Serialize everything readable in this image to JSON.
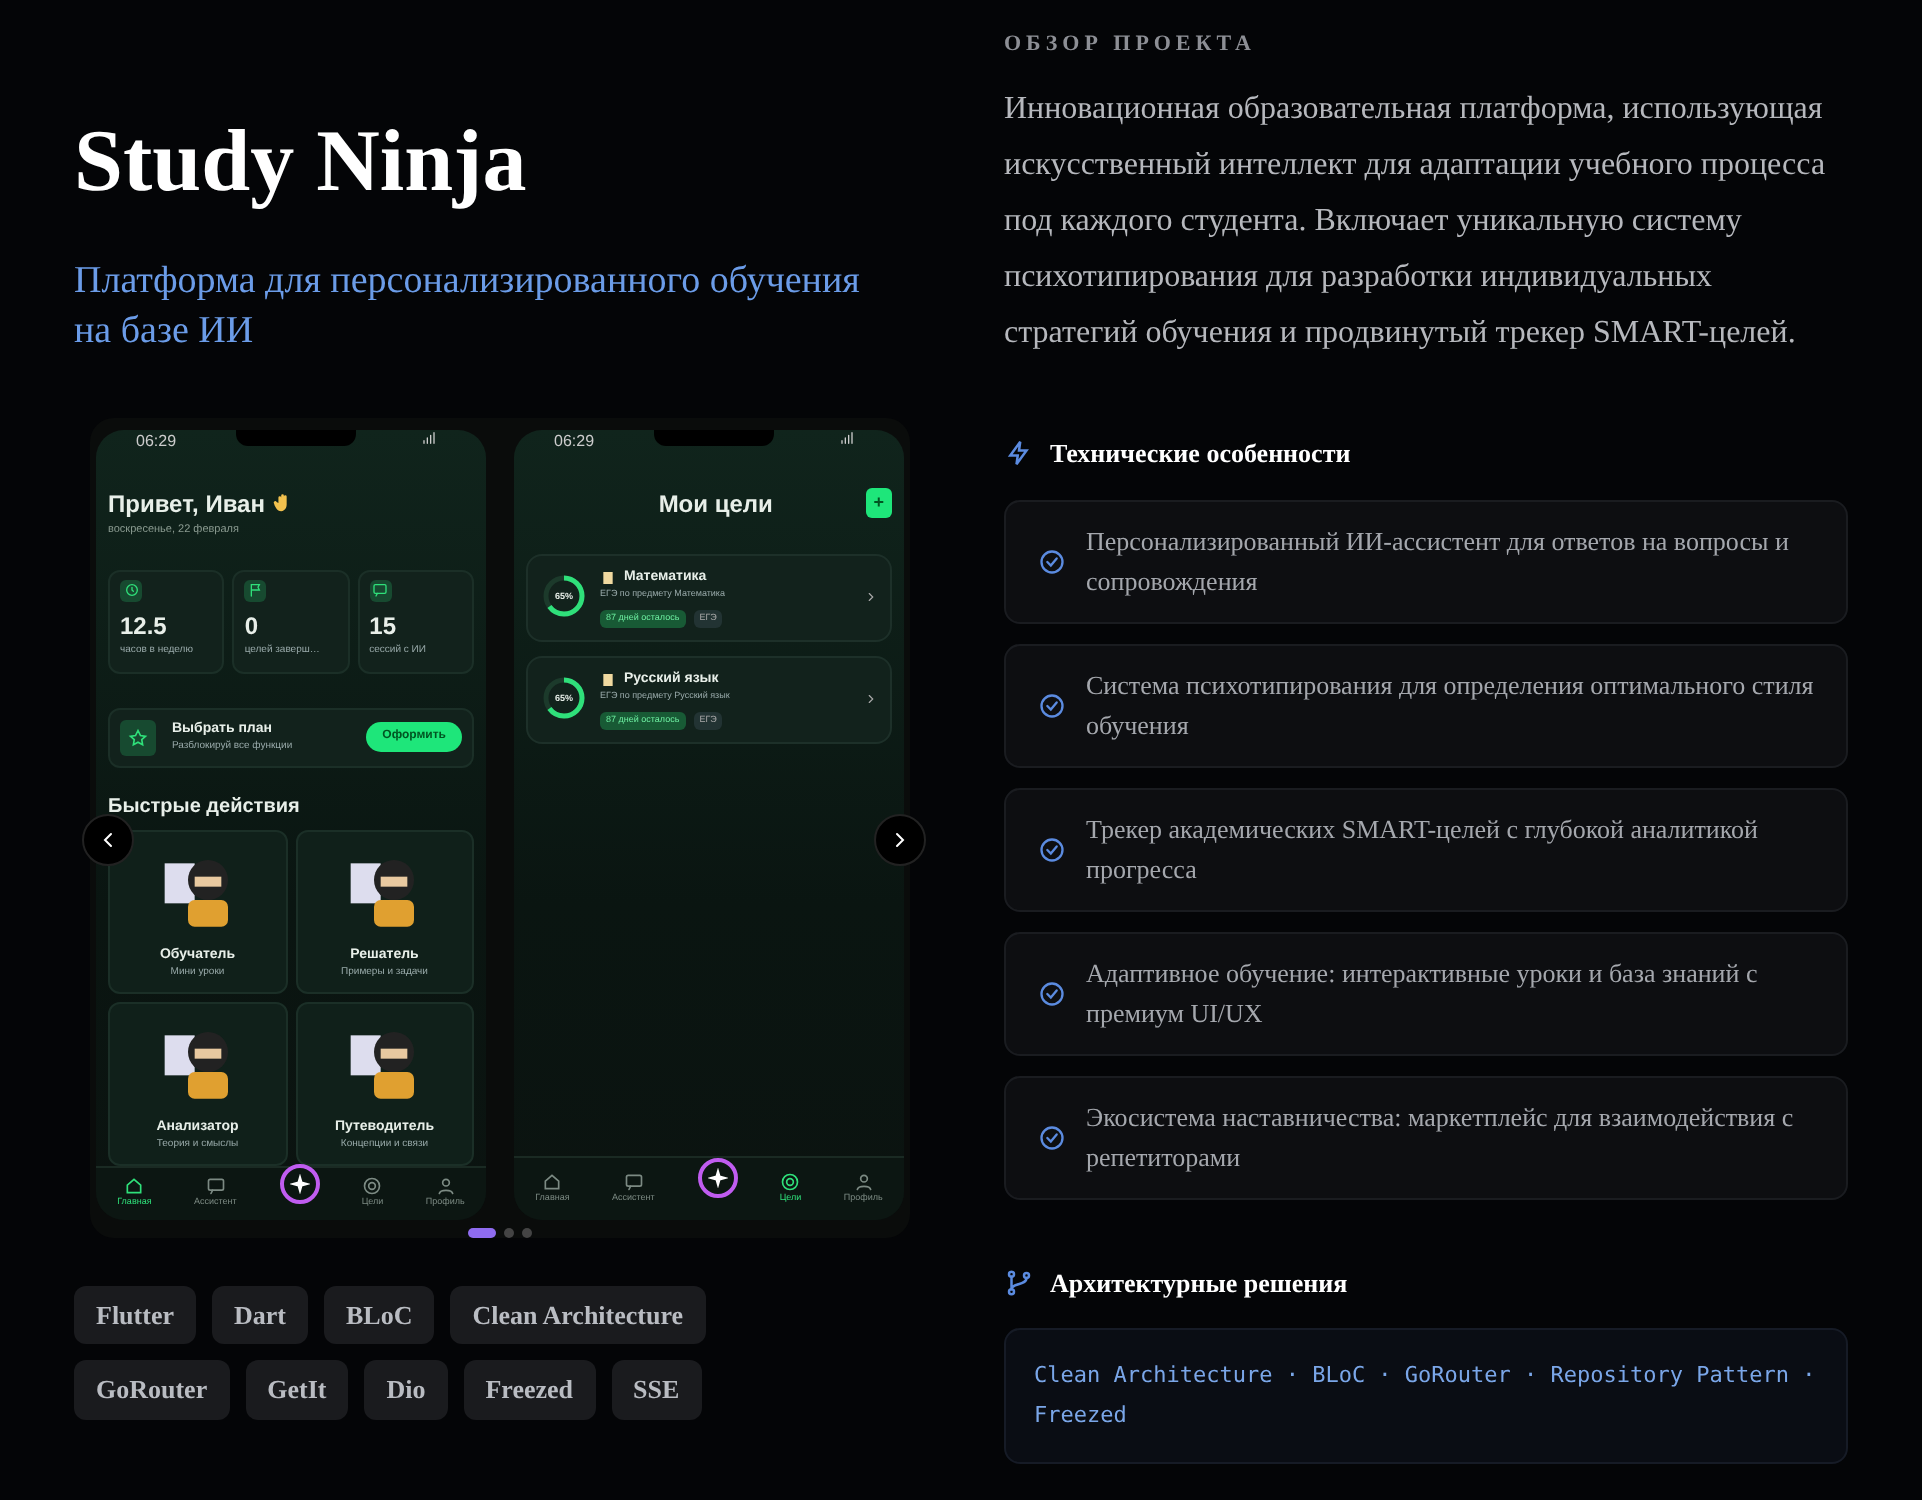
{
  "header": {
    "title": "Study Ninja",
    "subtitle": "Платформа для персонализированного обучения на базе ИИ"
  },
  "carousel": {
    "screens": [
      {
        "kind": "home",
        "time": "06:29",
        "greeting": "Привет, Иван",
        "date": "воскресенье, 22 февраля",
        "stats": [
          {
            "kind": "clock",
            "value": "12.5",
            "label": "часов в неделю"
          },
          {
            "kind": "flag",
            "value": "0",
            "label": "целей заверш…"
          },
          {
            "kind": "chat",
            "value": "15",
            "label": "сессий с ИИ"
          }
        ],
        "plan": {
          "title": "Выбрать план",
          "subtitle": "Разблокируй все функции",
          "button": "Оформить"
        },
        "section": "Быстрые действия",
        "actions": [
          {
            "title": "Обучатель",
            "subtitle": "Мини уроки"
          },
          {
            "title": "Решатель",
            "subtitle": "Примеры и задачи"
          },
          {
            "title": "Анализатор",
            "subtitle": "Теория и смыслы"
          },
          {
            "title": "Путеводитель",
            "subtitle": "Концепции и связи"
          }
        ],
        "nav": [
          {
            "kind": "home",
            "label": "Главная",
            "selected": true
          },
          {
            "kind": "chat",
            "label": "Ассистент",
            "selected": false
          },
          {
            "kind": "target",
            "label": "Цели",
            "selected": false
          },
          {
            "kind": "user",
            "label": "Профиль",
            "selected": false
          }
        ]
      },
      {
        "kind": "goals",
        "time": "06:29",
        "title": "Мои цели",
        "add": "+",
        "goals": [
          {
            "title": "Математика",
            "subtitle": "ЕГЭ по предмету Математика",
            "percent": "65%",
            "level": 0.65,
            "badge": "87 дней осталось",
            "tag": "ЕГЭ"
          },
          {
            "title": "Русский язык",
            "subtitle": "ЕГЭ по предмету Русский язык",
            "percent": "65%",
            "level": 0.65,
            "badge": "87 дней осталось",
            "tag": "ЕГЭ"
          }
        ],
        "nav": [
          {
            "kind": "home",
            "label": "Главная",
            "selected": false
          },
          {
            "kind": "chat",
            "label": "Ассистент",
            "selected": false
          },
          {
            "kind": "target",
            "label": "Цели",
            "selected": true
          },
          {
            "kind": "user",
            "label": "Профиль",
            "selected": false
          }
        ]
      }
    ],
    "dots": [
      {
        "selected": true
      },
      {
        "selected": false
      },
      {
        "selected": false
      }
    ]
  },
  "tags": [
    "Flutter",
    "Dart",
    "BLoC",
    "Clean Architecture",
    "GoRouter",
    "GetIt",
    "Dio",
    "Freezed",
    "SSE"
  ],
  "overview": {
    "label": "ОБЗОР ПРОЕКТА",
    "text": "Инновационная образовательная платформа, использующая искусственный интеллект для адаптации учебного процесса под каждого студента. Включает уникальную систему психотипирования для разработки индивидуальных стратегий обучения и продвинутый трекер SMART-целей."
  },
  "features": {
    "title": "Технические особенности",
    "items": [
      "Персонализированный ИИ-ассистент для ответов на вопросы и сопровождения",
      "Система психотипирования для определения оптимального стиля обучения",
      "Трекер академических SMART-целей с глубокой аналитикой прогресса",
      "Адаптивное обучение: интерактивные уроки и база знаний с премиум UI/UX",
      "Экосистема наставничества: маркетплейс для взаимодействия с репетиторами"
    ]
  },
  "architecture": {
    "title": "Архитектурные решения",
    "text": "Clean Architecture · BLoC · GoRouter · Repository Pattern · Freezed"
  }
}
